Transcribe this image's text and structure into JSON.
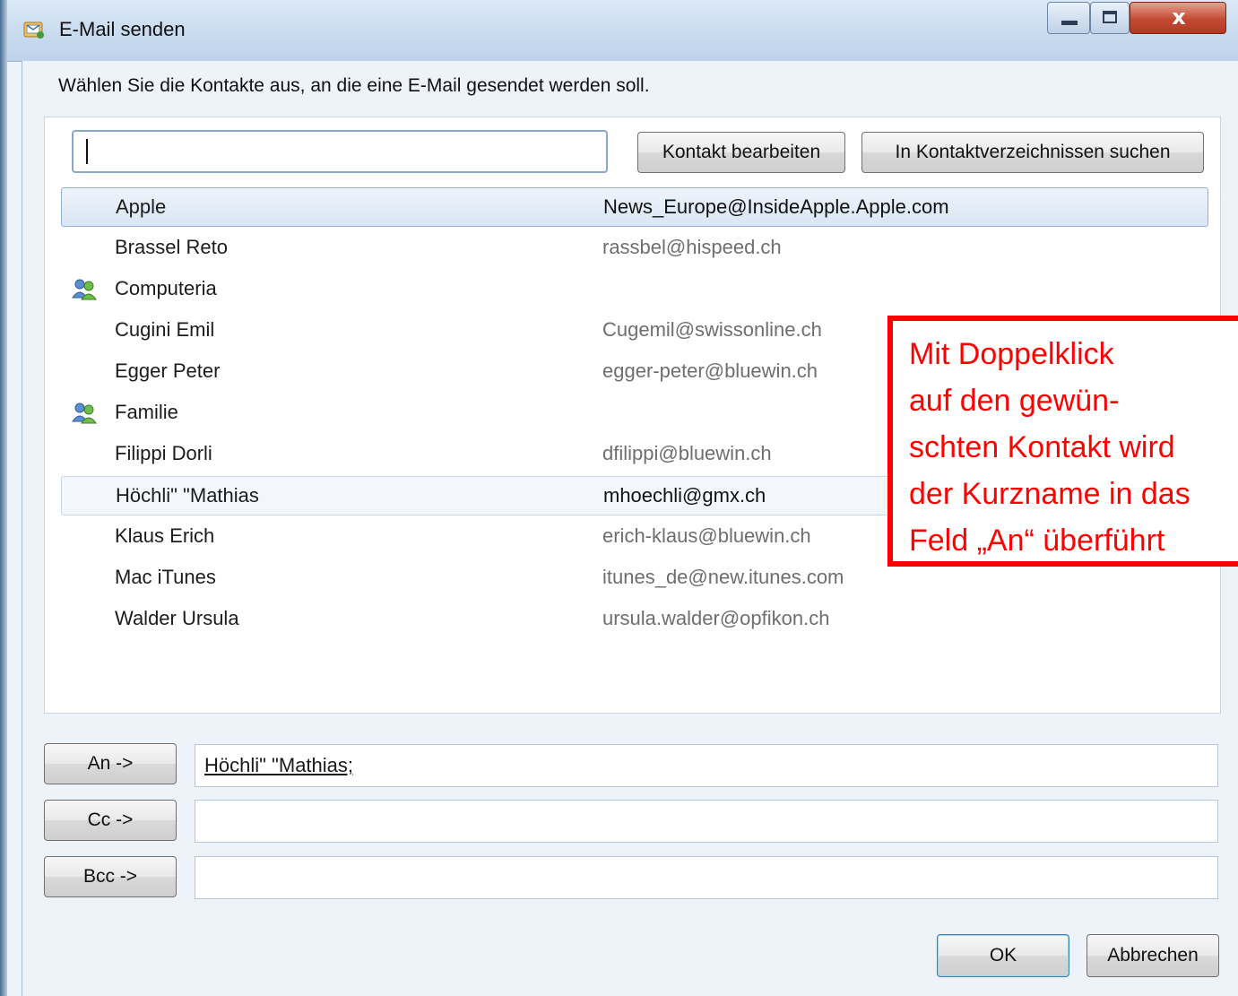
{
  "window": {
    "title": "E-Mail senden"
  },
  "instruction": "Wählen Sie die Kontakte aus, an die eine E-Mail gesendet werden soll.",
  "search": {
    "value": ""
  },
  "toolbar": {
    "edit_label": "Kontakt bearbeiten",
    "search_directories_label": "In Kontaktverzeichnissen suchen"
  },
  "contacts": [
    {
      "name": "Apple",
      "email": "News_Europe@InsideApple.Apple.com",
      "group": false,
      "selected": true
    },
    {
      "name": "Brassel Reto",
      "email": "rassbel@hispeed.ch",
      "group": false
    },
    {
      "name": "Computeria",
      "email": "",
      "group": true
    },
    {
      "name": "Cugini Emil",
      "email": "Cugemil@swissonline.ch",
      "group": false
    },
    {
      "name": "Egger Peter",
      "email": "egger-peter@bluewin.ch",
      "group": false
    },
    {
      "name": "Familie",
      "email": "",
      "group": true
    },
    {
      "name": "Filippi Dorli",
      "email": "dfilippi@bluewin.ch",
      "group": false
    },
    {
      "name": "Höchli\" \"Mathias",
      "email": "mhoechli@gmx.ch",
      "group": false,
      "focused": true
    },
    {
      "name": "Klaus Erich",
      "email": "erich-klaus@bluewin.ch",
      "group": false
    },
    {
      "name": "Mac iTunes",
      "email": "itunes_de@new.itunes.com",
      "group": false
    },
    {
      "name": "Walder Ursula",
      "email": "ursula.walder@opfikon.ch",
      "group": false
    }
  ],
  "recipients": {
    "to_label": "An ->",
    "to_value": "Höchli\" \"Mathias;",
    "cc_label": "Cc ->",
    "cc_value": "",
    "bcc_label": "Bcc ->",
    "bcc_value": ""
  },
  "footer": {
    "ok_label": "OK",
    "cancel_label": "Abbrechen"
  },
  "callout": {
    "lines": [
      "Mit Doppelklick",
      "auf den gewün-",
      "schten Kontakt wird",
      "der Kurzname in das",
      "Feld „An“ überführt"
    ]
  },
  "colors": {
    "callout": "#ff0000",
    "selection_border": "#8fb0d4"
  },
  "icons": {
    "group": "group-contacts-icon",
    "app": "mail-window-icon"
  }
}
